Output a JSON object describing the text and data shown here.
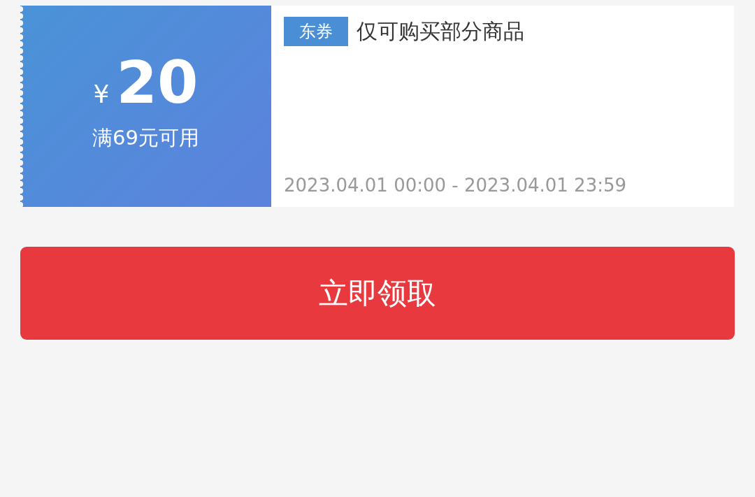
{
  "coupon": {
    "currency": "¥",
    "amount": "20",
    "condition": "满69元可用",
    "tag": "东券",
    "title": "仅可购买部分商品",
    "validity": "2023.04.01 00:00 - 2023.04.01 23:59"
  },
  "button": {
    "label": "立即领取"
  }
}
